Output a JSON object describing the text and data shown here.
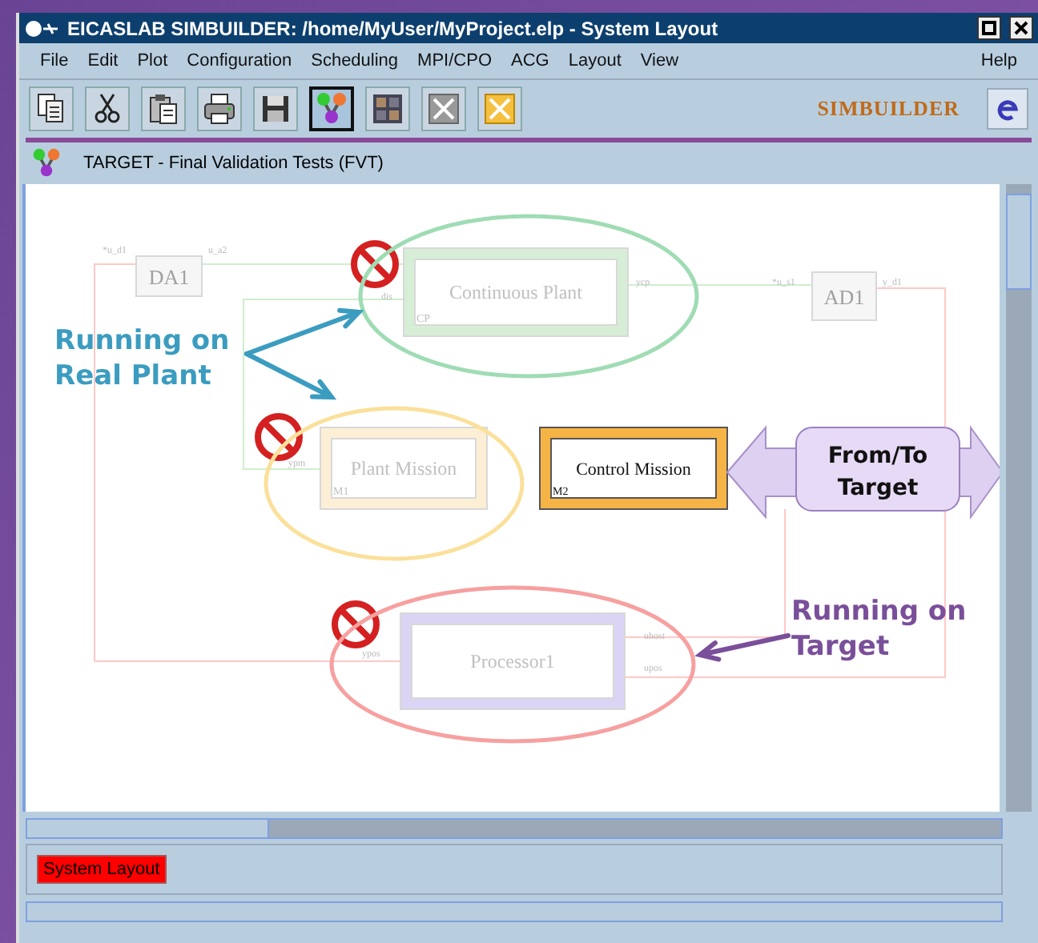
{
  "window": {
    "title": "EICASLAB  SIMBUILDER: /home/MyUser/MyProject.elp - System Layout"
  },
  "menu": [
    {
      "label": "File"
    },
    {
      "label": "Edit"
    },
    {
      "label": "Plot"
    },
    {
      "label": "Configuration"
    },
    {
      "label": "Scheduling"
    },
    {
      "label": "MPI/CPO"
    },
    {
      "label": "ACG"
    },
    {
      "label": "Layout"
    },
    {
      "label": "View"
    }
  ],
  "help_menu": {
    "label": "Help"
  },
  "toolbar": {
    "buttons": [
      {
        "kind": "copy",
        "selected": false
      },
      {
        "kind": "cut",
        "selected": false
      },
      {
        "kind": "paste",
        "selected": false
      },
      {
        "kind": "print",
        "selected": false
      },
      {
        "kind": "save",
        "selected": false
      },
      {
        "kind": "network",
        "selected": true
      },
      {
        "kind": "grid",
        "selected": false
      },
      {
        "kind": "cross",
        "selected": false
      },
      {
        "kind": "cross-yellow",
        "selected": false
      }
    ],
    "brand": "SIMBUILDER"
  },
  "header": {
    "title": "TARGET - Final Validation Tests (FVT)"
  },
  "diagram": {
    "blocks": [
      {
        "kind": "io",
        "label": "DA1",
        "faded": true,
        "blocked": false
      },
      {
        "kind": "module",
        "label": "Continuous Plant",
        "tag": "CP",
        "color": "#d6eed6",
        "faded": true,
        "blocked": true
      },
      {
        "kind": "io",
        "label": "AD1",
        "faded": true,
        "blocked": false
      },
      {
        "kind": "module",
        "label": "Plant Mission",
        "tag": "M1",
        "color": "#fcefd6",
        "faded": true,
        "blocked": true
      },
      {
        "kind": "module",
        "label": "Control Mission",
        "tag": "M2",
        "color": "#f7b446",
        "faded": false,
        "blocked": false
      },
      {
        "kind": "module",
        "label": "Processor1",
        "color": "#dcd4f4",
        "faded": true,
        "blocked": true
      }
    ],
    "highlights": [
      {
        "color": "#9fdcb4"
      },
      {
        "color": "#fbe09a"
      },
      {
        "color": "#f7a0a0"
      }
    ],
    "ports": [
      "*u_d1",
      "u_a2",
      "dis",
      "ycp",
      "*u_s1",
      "y_d1",
      "ypm",
      "ypos",
      "uhost",
      "upos"
    ],
    "callouts": [
      {
        "lines": [
          "Running on",
          "Real Plant"
        ],
        "color": "#3b9cc0"
      },
      {
        "lines": [
          "Running on",
          "Target"
        ],
        "color": "#7a4f9a"
      }
    ],
    "link": {
      "lines": [
        "From/To",
        "Target"
      ]
    }
  },
  "status": {
    "tab": "System Layout"
  }
}
